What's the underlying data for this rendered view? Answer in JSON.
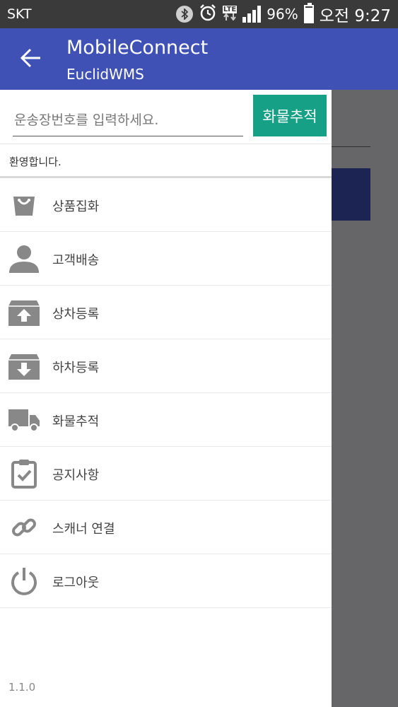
{
  "status_bar": {
    "carrier": "SKT",
    "lte_label": "LTE",
    "battery": "96%",
    "clock": "오전 9:27"
  },
  "app_bar": {
    "title": "MobileConnect",
    "subtitle": "EuclidWMS",
    "color": "#3f51b5"
  },
  "search": {
    "placeholder": "운송장번호를 입력하세요.",
    "value": "",
    "button_label": "화물추적",
    "button_color": "#16a085"
  },
  "welcome": "환영합니다.",
  "menu": [
    {
      "label": "상품집화",
      "icon": "shopping-bag-icon"
    },
    {
      "label": "고객배송",
      "icon": "person-icon"
    },
    {
      "label": "상차등록",
      "icon": "box-upload-icon"
    },
    {
      "label": "하차등록",
      "icon": "box-download-icon"
    },
    {
      "label": "화물추적",
      "icon": "truck-icon"
    },
    {
      "label": "공지사항",
      "icon": "clipboard-check-icon"
    },
    {
      "label": "스캐너 연결",
      "icon": "link-icon"
    },
    {
      "label": "로그아웃",
      "icon": "power-icon"
    }
  ],
  "version": "1.1.0"
}
